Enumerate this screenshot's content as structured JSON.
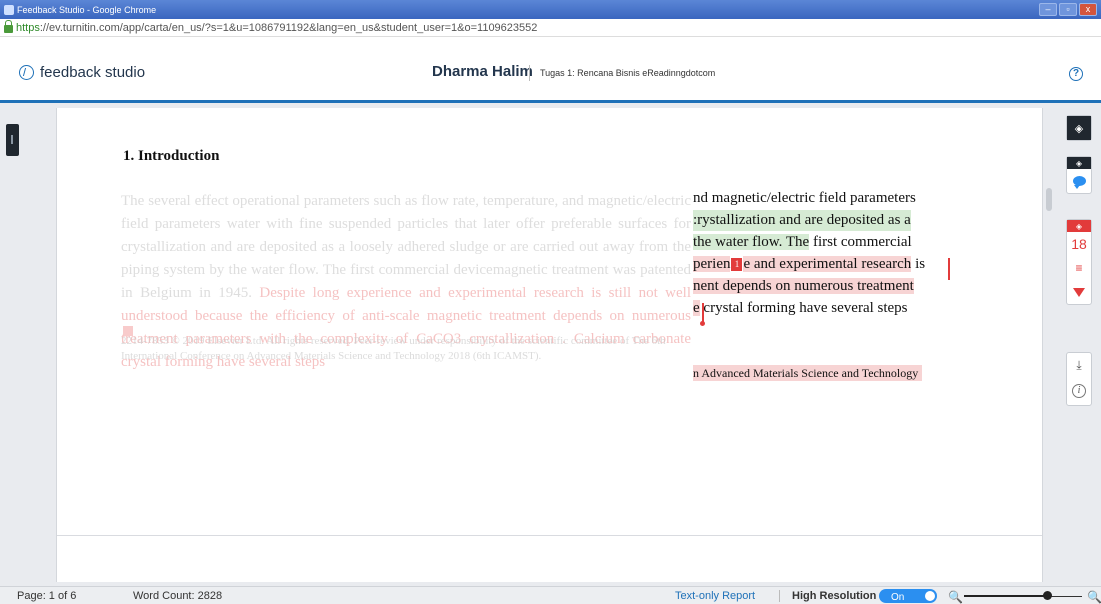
{
  "window": {
    "title": "Feedback Studio - Google Chrome",
    "minimize": "–",
    "maximize": "▫",
    "close": "x"
  },
  "address": {
    "scheme": "https",
    "rest": "://ev.turnitin.com/app/carta/en_us/?s=1&u=1086791192&lang=en_us&student_user=1&o=1109623552"
  },
  "header": {
    "brand": "feedback studio",
    "student_name": "Dharma Halim",
    "assignment": "Tugas 1: Rencana Bisnis eReadinngdotcom",
    "help": "?"
  },
  "document": {
    "heading": "1.  Introduction",
    "faded_paragraph": "The several effect operational parameters such as flow rate, temperature, and magnetic/electric field parameters water with fine suspended particles that later offer preferable surfaces for crystallization and are deposited as a loosely adhered sludge or are carried out away from the piping system by the water flow. The first commercial devicemagnetic treatment was patented in Belgium in 1945.",
    "faded_pink": "Despite long experience and experimental research is still not well understood because the efficiency of anti-scale magnetic treatment depends on numerous treatment parameters with the complexity of CaCO3 crystallization . Calcium carbonate crystal forming have several steps",
    "faded_footnote": "2214-7853 © 2019 Elsevier Ltd. All rights reserved. Peer-review under responsibility of the scientific committee of The 6th International Conference on Advanced Materials Science and Technology 2018 (6th ICAMST).",
    "clear_lines": {
      "l1": "nd magnetic/electric field parameters",
      "l2": ":rystallization and are deposited as a",
      "l3a": "the water flow. The",
      "l3b": " first commercial",
      "l4a": "perien",
      "l4b": "e and experimental research",
      "l4c": " is",
      "l5a": "nent ",
      "l5b": "depends on numerous treatment",
      "l6a": "e",
      "l6b": "  crystal forming have several steps"
    },
    "match_number": "1",
    "clear_footnote": "n Advanced Materials Science and Technology"
  },
  "right_panel": {
    "layers_glyph": "◈",
    "similarity_score": "18",
    "bars_glyph": "≡",
    "download_glyph": "⤓",
    "info_glyph": "i"
  },
  "statusbar": {
    "page": "Page: 1 of 6",
    "word_count": "Word Count: 2828",
    "text_only_report": "Text-only Report",
    "high_resolution": "High Resolution",
    "toggle_state": "On",
    "zoom_out": "🔍",
    "zoom_in": "🔍",
    "zoom_level": 0.7
  },
  "colors": {
    "accent": "#1f71b8",
    "similarity_red": "#e23b3b",
    "match_green": "#d6ebd4",
    "match_pink": "#f7d4d4"
  }
}
